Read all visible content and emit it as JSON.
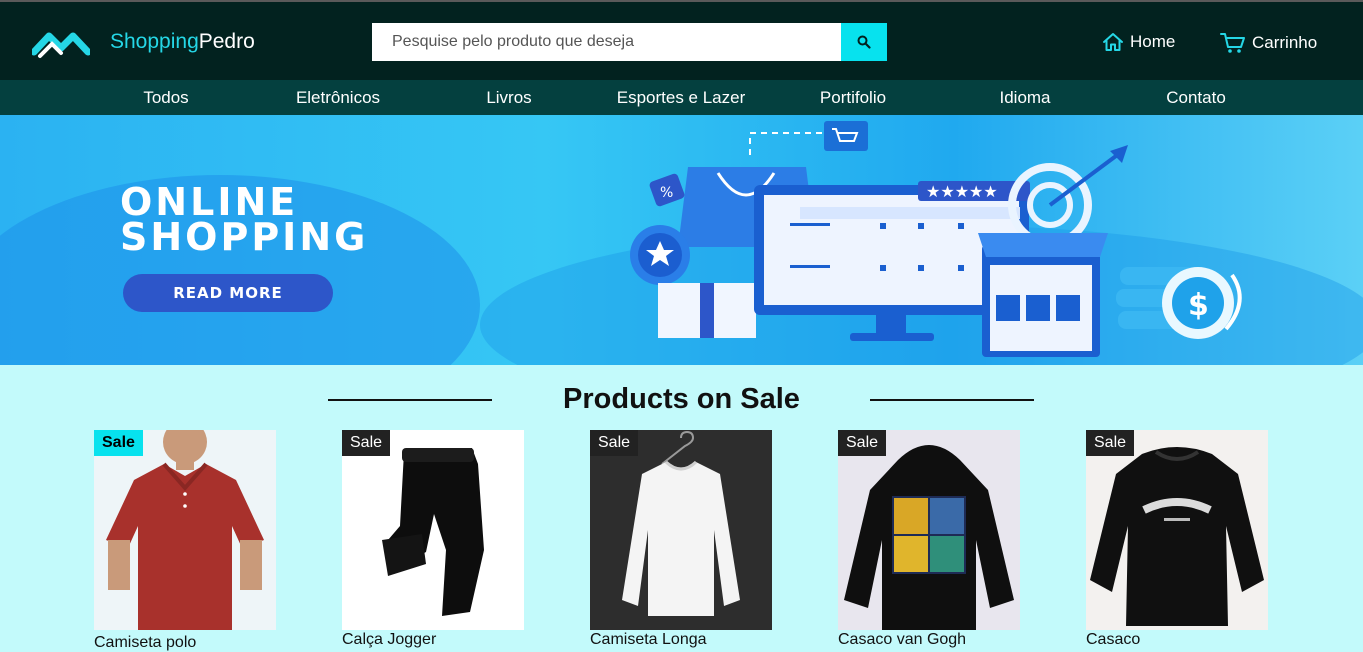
{
  "header": {
    "brand_part1": "Shopping",
    "brand_part2": "Pedro",
    "search_placeholder": "Pesquise pelo produto que deseja",
    "home_label": "Home",
    "cart_label": "Carrinho",
    "accent_color": "#07e2ee"
  },
  "menu": {
    "items": [
      {
        "label": "Todos"
      },
      {
        "label": "Eletrônicos"
      },
      {
        "label": "Livros"
      },
      {
        "label": "Esportes e Lazer"
      },
      {
        "label": "Portifolio"
      },
      {
        "label": "Idioma"
      },
      {
        "label": "Contato"
      }
    ]
  },
  "banner": {
    "title_line1": "ONLINE",
    "title_line2": "SHOPPING",
    "button_label": "READ MORE"
  },
  "sale_section": {
    "title": "Products on Sale",
    "products": [
      {
        "badge": "Sale",
        "name": "Camiseta polo"
      },
      {
        "badge": "Sale",
        "name": "Calça Jogger"
      },
      {
        "badge": "Sale",
        "name": "Camiseta Longa"
      },
      {
        "badge": "Sale",
        "name": "Casaco van Gogh"
      },
      {
        "badge": "Sale",
        "name": "Casaco"
      }
    ]
  }
}
